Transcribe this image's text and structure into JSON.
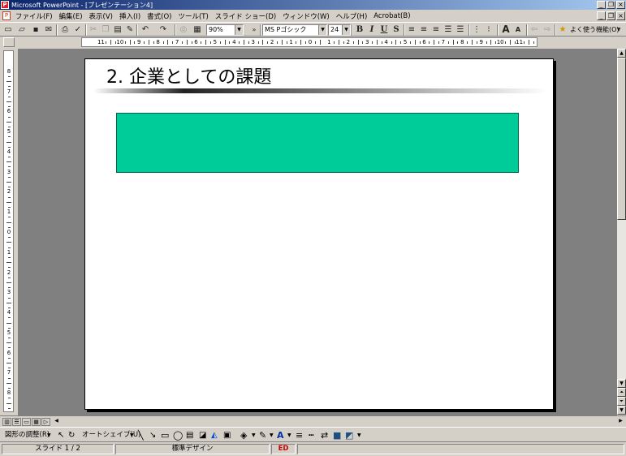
{
  "window": {
    "title": "Microsoft PowerPoint - [プレゼンテーション4]",
    "app_icon": "P",
    "minimize": "_",
    "restore": "❐",
    "close": "×"
  },
  "menu": {
    "items": [
      "ファイル(F)",
      "編集(E)",
      "表示(V)",
      "挿入(I)",
      "書式(O)",
      "ツール(T)",
      "スライド ショー(D)",
      "ウィンドウ(W)",
      "ヘルプ(H)",
      "Acrobat(B)"
    ]
  },
  "toolbar": {
    "zoom": "90%",
    "font": "MS Pゴシック",
    "font_size": "24",
    "bold": "B",
    "italic": "I",
    "underline": "U",
    "shadow": "S",
    "font_grow": "A",
    "font_shrink": "A",
    "often_used": "よく使う機能(O)"
  },
  "hruler": {
    "labels": [
      "11",
      "10",
      "9",
      "8",
      "7",
      "6",
      "5",
      "4",
      "3",
      "2",
      "1",
      "0",
      "1",
      "2",
      "3",
      "4",
      "5",
      "6",
      "7",
      "8",
      "9",
      "10",
      "11"
    ]
  },
  "vruler": {
    "labels": [
      "8",
      "7",
      "6",
      "5",
      "4",
      "3",
      "2",
      "1",
      "0",
      "1",
      "2",
      "3",
      "4",
      "5",
      "6",
      "7",
      "8"
    ]
  },
  "slide": {
    "title": "2. 企業としての課題",
    "box_color": "#00cc99"
  },
  "drawbar": {
    "draw_menu": "図形の調整(R)",
    "autoshape": "オートシェイプ(U)"
  },
  "status": {
    "slide": "スライド 1 / 2",
    "design": "標準デザイン",
    "lang": "ED"
  }
}
